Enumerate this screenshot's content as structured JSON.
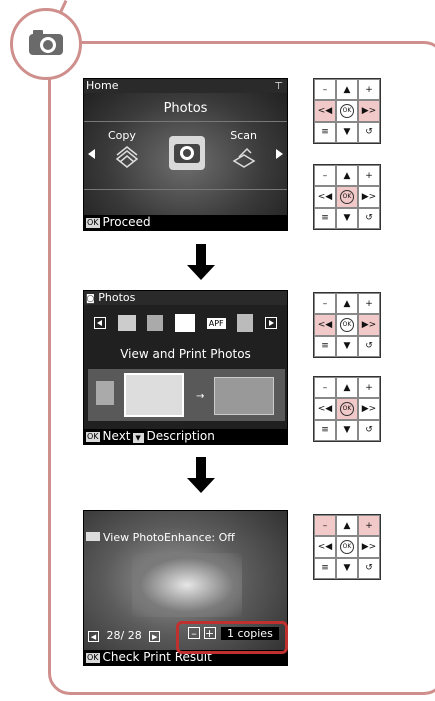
{
  "screen_home": {
    "title": "Home",
    "center_label": "Photos",
    "left_label": "Copy",
    "right_label": "Scan",
    "footer_tag": "OK",
    "footer_text": "Proceed"
  },
  "screen_photos": {
    "title": "Photos",
    "apf_label": "APF",
    "mid_label": "View and Print Photos",
    "footer_tag": "OK",
    "footer_next": "Next",
    "footer_desc": "Description"
  },
  "screen_view": {
    "top_overlay": "View PhotoEnhance: Off",
    "counter": "28/ 28",
    "copies": "1 copies",
    "footer_tag": "OK",
    "footer_text": "Check Print Result"
  },
  "keys": {
    "minus": "–",
    "up": "▲",
    "plus": "+",
    "left": "<◀",
    "ok": "OK",
    "right": "▶>",
    "menu": "≡",
    "down": "▼",
    "back": "↺"
  },
  "colors": {
    "frame": "#cf8f8c",
    "highlight_key": "#f1c9c8",
    "highlight_box": "#c0302e"
  }
}
